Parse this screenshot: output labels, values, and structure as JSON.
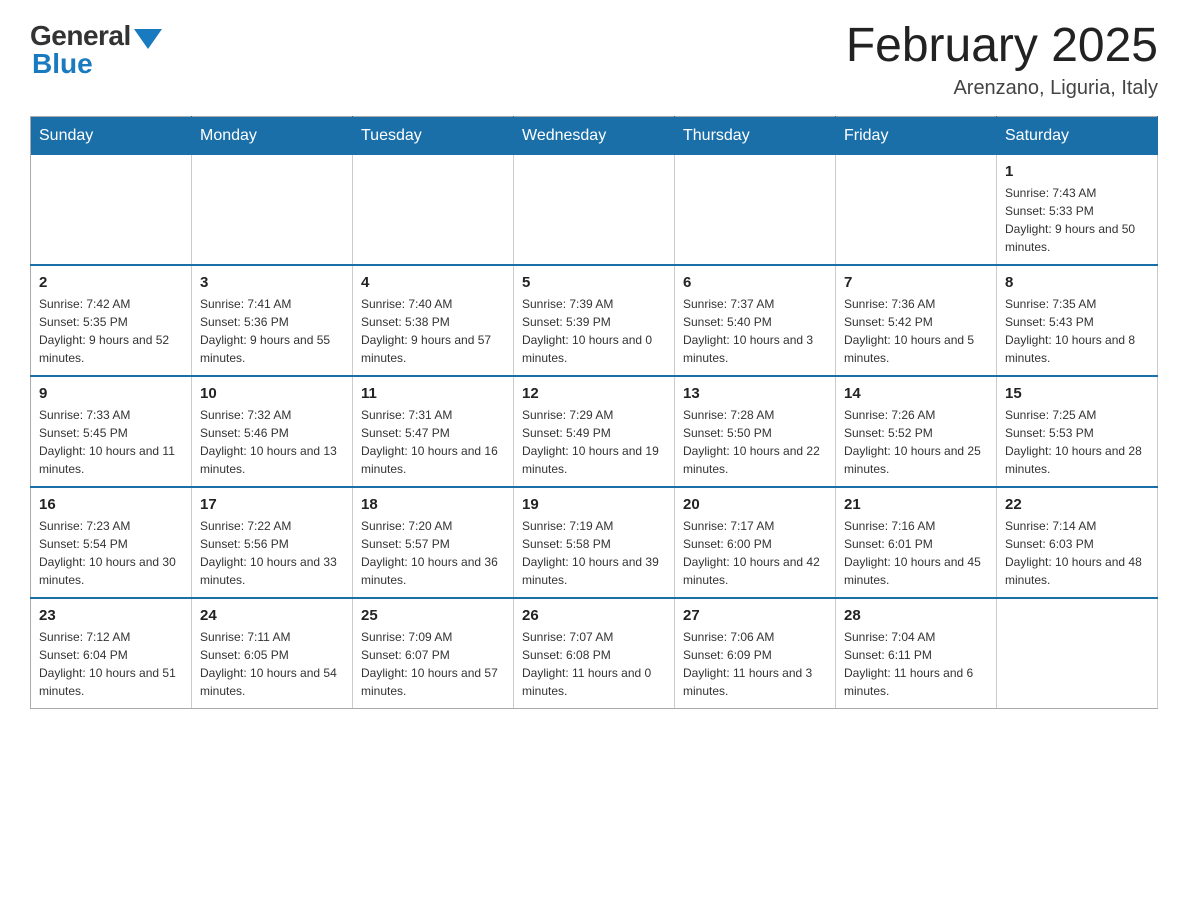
{
  "header": {
    "logo_general": "General",
    "logo_blue": "Blue",
    "month_title": "February 2025",
    "location": "Arenzano, Liguria, Italy"
  },
  "days_of_week": [
    "Sunday",
    "Monday",
    "Tuesday",
    "Wednesday",
    "Thursday",
    "Friday",
    "Saturday"
  ],
  "weeks": [
    [
      {
        "day": "",
        "info": ""
      },
      {
        "day": "",
        "info": ""
      },
      {
        "day": "",
        "info": ""
      },
      {
        "day": "",
        "info": ""
      },
      {
        "day": "",
        "info": ""
      },
      {
        "day": "",
        "info": ""
      },
      {
        "day": "1",
        "info": "Sunrise: 7:43 AM\nSunset: 5:33 PM\nDaylight: 9 hours and 50 minutes."
      }
    ],
    [
      {
        "day": "2",
        "info": "Sunrise: 7:42 AM\nSunset: 5:35 PM\nDaylight: 9 hours and 52 minutes."
      },
      {
        "day": "3",
        "info": "Sunrise: 7:41 AM\nSunset: 5:36 PM\nDaylight: 9 hours and 55 minutes."
      },
      {
        "day": "4",
        "info": "Sunrise: 7:40 AM\nSunset: 5:38 PM\nDaylight: 9 hours and 57 minutes."
      },
      {
        "day": "5",
        "info": "Sunrise: 7:39 AM\nSunset: 5:39 PM\nDaylight: 10 hours and 0 minutes."
      },
      {
        "day": "6",
        "info": "Sunrise: 7:37 AM\nSunset: 5:40 PM\nDaylight: 10 hours and 3 minutes."
      },
      {
        "day": "7",
        "info": "Sunrise: 7:36 AM\nSunset: 5:42 PM\nDaylight: 10 hours and 5 minutes."
      },
      {
        "day": "8",
        "info": "Sunrise: 7:35 AM\nSunset: 5:43 PM\nDaylight: 10 hours and 8 minutes."
      }
    ],
    [
      {
        "day": "9",
        "info": "Sunrise: 7:33 AM\nSunset: 5:45 PM\nDaylight: 10 hours and 11 minutes."
      },
      {
        "day": "10",
        "info": "Sunrise: 7:32 AM\nSunset: 5:46 PM\nDaylight: 10 hours and 13 minutes."
      },
      {
        "day": "11",
        "info": "Sunrise: 7:31 AM\nSunset: 5:47 PM\nDaylight: 10 hours and 16 minutes."
      },
      {
        "day": "12",
        "info": "Sunrise: 7:29 AM\nSunset: 5:49 PM\nDaylight: 10 hours and 19 minutes."
      },
      {
        "day": "13",
        "info": "Sunrise: 7:28 AM\nSunset: 5:50 PM\nDaylight: 10 hours and 22 minutes."
      },
      {
        "day": "14",
        "info": "Sunrise: 7:26 AM\nSunset: 5:52 PM\nDaylight: 10 hours and 25 minutes."
      },
      {
        "day": "15",
        "info": "Sunrise: 7:25 AM\nSunset: 5:53 PM\nDaylight: 10 hours and 28 minutes."
      }
    ],
    [
      {
        "day": "16",
        "info": "Sunrise: 7:23 AM\nSunset: 5:54 PM\nDaylight: 10 hours and 30 minutes."
      },
      {
        "day": "17",
        "info": "Sunrise: 7:22 AM\nSunset: 5:56 PM\nDaylight: 10 hours and 33 minutes."
      },
      {
        "day": "18",
        "info": "Sunrise: 7:20 AM\nSunset: 5:57 PM\nDaylight: 10 hours and 36 minutes."
      },
      {
        "day": "19",
        "info": "Sunrise: 7:19 AM\nSunset: 5:58 PM\nDaylight: 10 hours and 39 minutes."
      },
      {
        "day": "20",
        "info": "Sunrise: 7:17 AM\nSunset: 6:00 PM\nDaylight: 10 hours and 42 minutes."
      },
      {
        "day": "21",
        "info": "Sunrise: 7:16 AM\nSunset: 6:01 PM\nDaylight: 10 hours and 45 minutes."
      },
      {
        "day": "22",
        "info": "Sunrise: 7:14 AM\nSunset: 6:03 PM\nDaylight: 10 hours and 48 minutes."
      }
    ],
    [
      {
        "day": "23",
        "info": "Sunrise: 7:12 AM\nSunset: 6:04 PM\nDaylight: 10 hours and 51 minutes."
      },
      {
        "day": "24",
        "info": "Sunrise: 7:11 AM\nSunset: 6:05 PM\nDaylight: 10 hours and 54 minutes."
      },
      {
        "day": "25",
        "info": "Sunrise: 7:09 AM\nSunset: 6:07 PM\nDaylight: 10 hours and 57 minutes."
      },
      {
        "day": "26",
        "info": "Sunrise: 7:07 AM\nSunset: 6:08 PM\nDaylight: 11 hours and 0 minutes."
      },
      {
        "day": "27",
        "info": "Sunrise: 7:06 AM\nSunset: 6:09 PM\nDaylight: 11 hours and 3 minutes."
      },
      {
        "day": "28",
        "info": "Sunrise: 7:04 AM\nSunset: 6:11 PM\nDaylight: 11 hours and 6 minutes."
      },
      {
        "day": "",
        "info": ""
      }
    ]
  ]
}
